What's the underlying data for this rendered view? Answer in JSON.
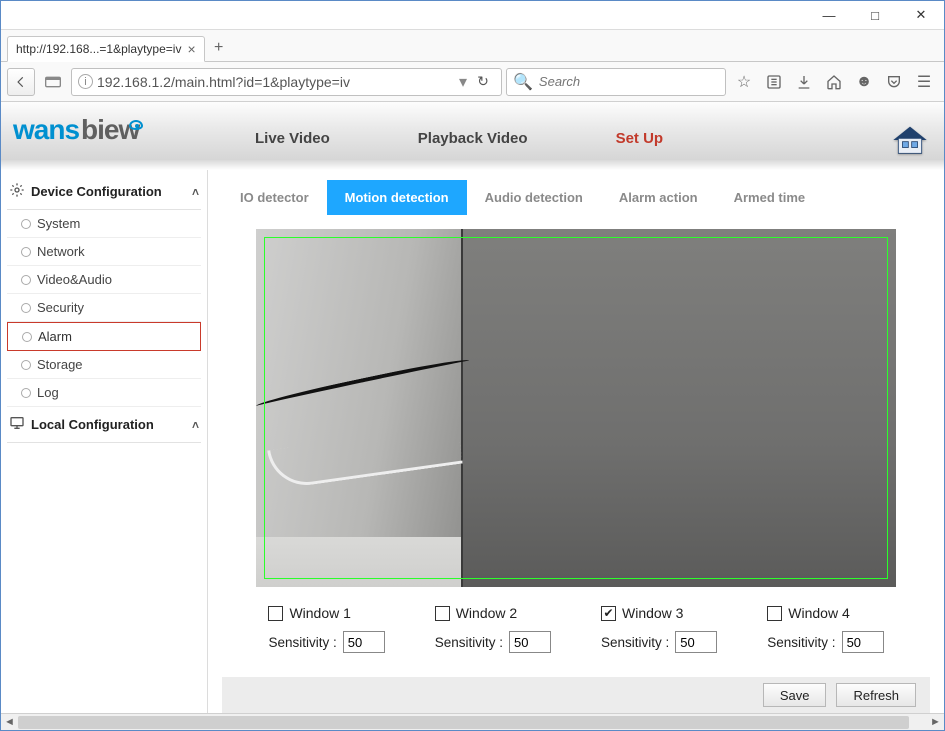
{
  "window": {
    "controls": {
      "min": "—",
      "max": "□",
      "close": "✕"
    }
  },
  "browser": {
    "tab_title": "http://192.168...=1&playtype=iv",
    "url": "192.168.1.2/main.html?id=1&playtype=iv",
    "search_placeholder": "Search"
  },
  "brand": {
    "part1": "wans",
    "part2": "biew"
  },
  "nav": {
    "live": "Live Video",
    "playback": "Playback Video",
    "setup": "Set Up"
  },
  "sidebar": {
    "group_device": "Device Configuration",
    "items": [
      {
        "label": "System"
      },
      {
        "label": "Network"
      },
      {
        "label": "Video&Audio"
      },
      {
        "label": "Security"
      },
      {
        "label": "Alarm"
      },
      {
        "label": "Storage"
      },
      {
        "label": "Log"
      }
    ],
    "group_local": "Local Configuration"
  },
  "subtabs": {
    "io": "IO detector",
    "motion": "Motion detection",
    "audio": "Audio detection",
    "action": "Alarm action",
    "armed": "Armed time"
  },
  "windows": [
    {
      "label": "Window 1",
      "checked": false,
      "sens_label": "Sensitivity :",
      "sens_value": "50"
    },
    {
      "label": "Window 2",
      "checked": false,
      "sens_label": "Sensitivity :",
      "sens_value": "50"
    },
    {
      "label": "Window 3",
      "checked": true,
      "sens_label": "Sensitivity :",
      "sens_value": "50"
    },
    {
      "label": "Window 4",
      "checked": false,
      "sens_label": "Sensitivity :",
      "sens_value": "50"
    }
  ],
  "actions": {
    "save": "Save",
    "refresh": "Refresh"
  }
}
